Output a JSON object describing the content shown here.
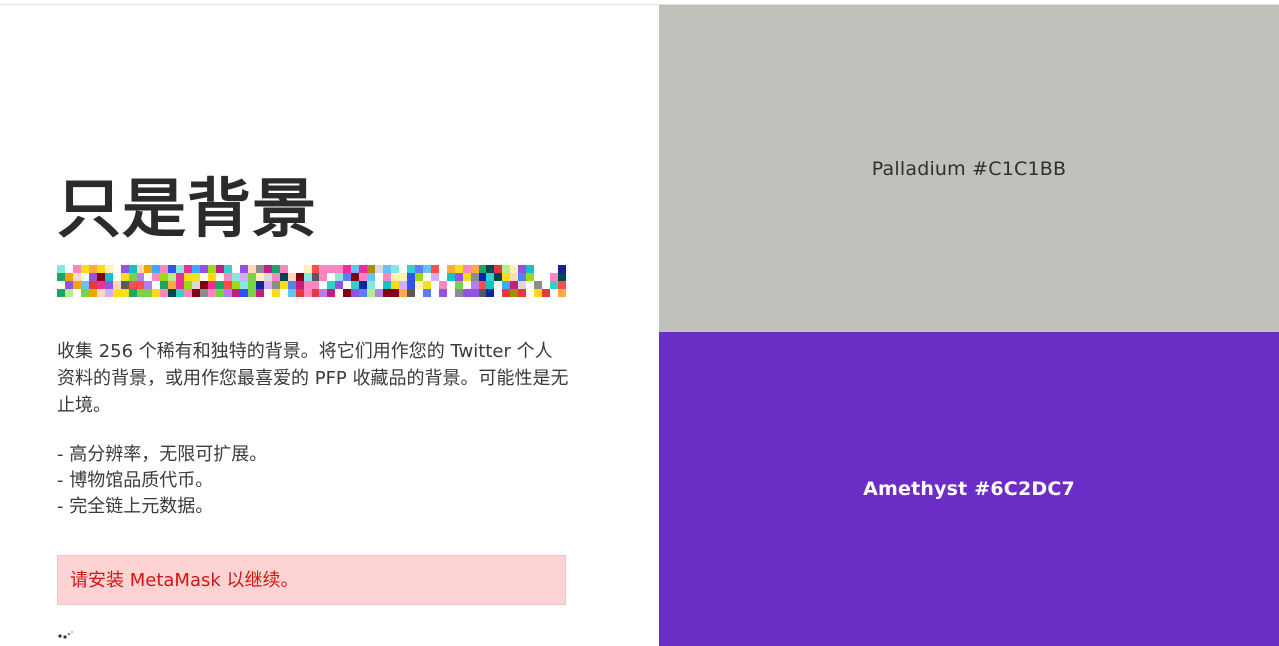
{
  "hero": {
    "title": "只是背景",
    "description": "收集 256 个稀有和独特的背景。将它们用作您的 Twitter 个人资料的背景，或用作您最喜爱的 PFP 收藏品的背景。可能性是无止境。",
    "features": [
      "- 高分辨率，无限可扩展。",
      "- 博物馆品质代币。",
      "- 完全链上元数据。"
    ]
  },
  "alert": {
    "text": "请安装 MetaMask 以继续。"
  },
  "swatches": [
    {
      "label": "Palladium #C1C1BB",
      "color": "#C1C1BB"
    },
    {
      "label": "Amethyst #6C2DC7",
      "color": "#6C2DC7"
    }
  ],
  "pixel_palette": [
    "#e33b3b",
    "#f0a500",
    "#f7e017",
    "#7bd148",
    "#21a366",
    "#13c2c2",
    "#2f54eb",
    "#9254de",
    "#eb2f96",
    "#fadb14",
    "#a0d911",
    "#36cfc9",
    "#597ef7",
    "#b37feb",
    "#ff85c0",
    "#ffd8bf",
    "#d3adf7",
    "#87e8de",
    "#ffa940",
    "#8c8c8c",
    "#595959",
    "#fff1b8",
    "#b7eb8f",
    "#69c0ff",
    "#c41d7f",
    "#820014",
    "#10239e",
    "#ad8b00",
    "#00474f",
    "#d9d9d9",
    "#ff4d4f",
    "#40a9ff"
  ]
}
